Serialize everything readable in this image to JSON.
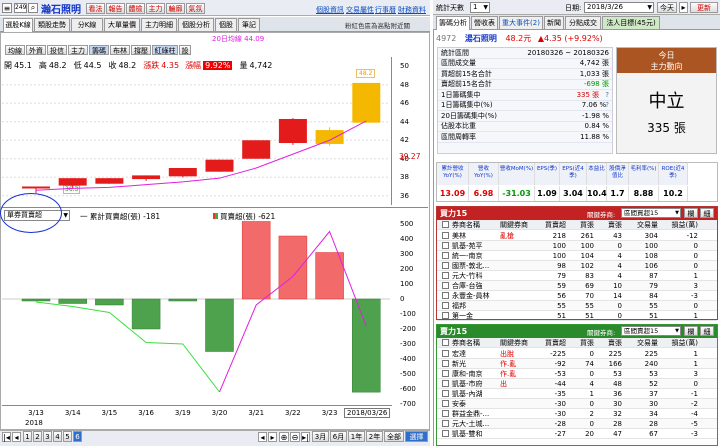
{
  "left_toolbar": {
    "code": "2499",
    "name": "瀚石照明",
    "buttons": [
      "看法",
      "報告",
      "體檢",
      "主力",
      "輪廓",
      "氣氛"
    ],
    "links": [
      "個股資訊",
      "交易屬性",
      "行事曆",
      "財務資料"
    ]
  },
  "left_tabs": [
    "選股K線",
    "類股走勢",
    "分K線",
    "大單量價",
    "主力明細",
    "個股分析",
    "個股",
    "筆記"
  ],
  "subtitle": "粉紅色區為高點附近關",
  "chart_buttons": [
    "均線",
    "外資",
    "投信",
    "主力",
    "籌碼",
    "布林",
    "撐壓",
    "紅綠柱",
    "設"
  ],
  "ohlc": {
    "open_label": "開",
    "open": "45.1",
    "high_label": "高",
    "high": "48.2",
    "low_label": "低",
    "low": "44.5",
    "close_label": "收",
    "close": "48.2",
    "chg_label": "漲跌",
    "chg": "4.35",
    "pct_label": "漲幅",
    "pct": "9.92%",
    "vol_label": "量",
    "vol": "4,742"
  },
  "legend_ma": "20日均線 44.09",
  "price_axis": [
    "50",
    "48",
    "46",
    "44",
    "42",
    "40",
    "38",
    "36"
  ],
  "price_current": "39.27",
  "peak_label": "48.2",
  "low_label": "36.3",
  "indicator": {
    "select": "單券買賣超",
    "series1": "一 累計買賣超(張)",
    "val1": "-181",
    "series2": "買賣超(張)",
    "val2": "-621"
  },
  "ind_axis": [
    "500",
    "400",
    "300",
    "200",
    "100",
    "0",
    "-100",
    "-200",
    "-300",
    "-400",
    "-500",
    "-600",
    "-700"
  ],
  "x_dates": [
    "3/13",
    "3/14",
    "3/15",
    "3/16",
    "3/19",
    "3/20",
    "3/21",
    "3/22",
    "3/23"
  ],
  "x_year": "2018",
  "x_cursor": "2018/03/26",
  "bottom_bar": {
    "pages": [
      "1",
      "2",
      "3",
      "4",
      "5",
      "6"
    ],
    "ranges": [
      "3月",
      "6月",
      "1年",
      "2年",
      "全部",
      "選擇"
    ]
  },
  "right_top": {
    "label": "統計天數",
    "days": "1",
    "date_label": "日期:",
    "date": "2018/3/26",
    "today": "今天",
    "refresh": "更新"
  },
  "right_tabs": [
    "籌碼分析",
    "營收表",
    "重大事件(2)",
    "新聞",
    "分點成交",
    "法人目標(45元)"
  ],
  "stock_header": {
    "code": "4972",
    "name": "湯石照明",
    "price": "48.2元",
    "chg": "▲4.35 (+9.92%)"
  },
  "stats": [
    {
      "k": "統計區間",
      "v": "20180326 ~ 20180326"
    },
    {
      "k": "區間成交量",
      "v": "4,742 張"
    },
    {
      "k": "買超前15名合計",
      "v": "1,033 張"
    },
    {
      "k": "賣超前15名合計",
      "v": "-698 張"
    },
    {
      "k": "1日籌碼集中",
      "v": "335 張"
    },
    {
      "k": "1日籌碼集中(%)",
      "v": "7.06 %"
    },
    {
      "k": "20日籌碼集中(%)",
      "v": "-1.98 %"
    },
    {
      "k": "佔股本比重",
      "v": "0.84 %"
    },
    {
      "k": "區間周轉率",
      "v": "11.88 %"
    }
  ],
  "today_box": {
    "t1": "今日",
    "t2": "主力動向",
    "status": "中立",
    "amount": "335 張"
  },
  "metrics": {
    "headers": [
      "累計營收YoY(%)",
      "營收YoY(%)",
      "營收MoM(%)",
      "EPS(季)",
      "EPS(近4季)",
      "本益比",
      "股價淨值比",
      "毛利率(%)",
      "ROE(近4季)"
    ],
    "values": [
      "13.09",
      "6.98",
      "-31.03",
      "1.09",
      "3.04",
      "10.4",
      "1.7",
      "8.88",
      "10.2"
    ]
  },
  "buy_table": {
    "title": "買力15",
    "ask": "關鍵券商:",
    "select": "區間買超15",
    "b1": "欄",
    "b2": "細",
    "headers": [
      "券商名稱",
      "關鍵券商",
      "買賣超",
      "買張",
      "賣張",
      "交易量",
      "損益(萬)"
    ],
    "rows": [
      [
        "美林",
        "亂槍",
        "218",
        "261",
        "43",
        "304",
        "-12"
      ],
      [
        "凱基-苑平",
        "",
        "100",
        "100",
        "0",
        "100",
        "0"
      ],
      [
        "統一-南京",
        "",
        "100",
        "104",
        "4",
        "108",
        "0"
      ],
      [
        "國票-敦北...",
        "",
        "98",
        "102",
        "4",
        "106",
        "0"
      ],
      [
        "元大-竹科",
        "",
        "79",
        "83",
        "4",
        "87",
        "1"
      ],
      [
        "合庫-台強",
        "",
        "59",
        "69",
        "10",
        "79",
        "3"
      ],
      [
        "永豐金-員林",
        "",
        "56",
        "70",
        "14",
        "84",
        "-3"
      ],
      [
        "福邦",
        "",
        "55",
        "55",
        "0",
        "55",
        "0"
      ],
      [
        "第一金",
        "",
        "51",
        "51",
        "0",
        "51",
        "1"
      ]
    ]
  },
  "sell_table": {
    "title": "賣力15",
    "ask": "關鍵券商:",
    "select": "區間賣超15",
    "b1": "欄",
    "b2": "細",
    "headers": [
      "券商名稱",
      "關鍵券商",
      "買賣超",
      "買張",
      "賣張",
      "交易量",
      "損益(萬)"
    ],
    "rows": [
      [
        "宏達",
        "出脫",
        "-225",
        "0",
        "225",
        "225",
        "1"
      ],
      [
        "新光",
        "作.亂",
        "-92",
        "74",
        "166",
        "240",
        "1"
      ],
      [
        "康和-南京",
        "作.亂",
        "-53",
        "0",
        "53",
        "53",
        "3"
      ],
      [
        "凱基-市府",
        "出",
        "-44",
        "4",
        "48",
        "52",
        "0"
      ],
      [
        "凱基-內湖",
        "",
        "-35",
        "1",
        "36",
        "37",
        "-1"
      ],
      [
        "安泰",
        "",
        "-30",
        "0",
        "30",
        "30",
        "-2"
      ],
      [
        "群益金鼎-...",
        "",
        "-30",
        "2",
        "32",
        "34",
        "-4"
      ],
      [
        "元大-土城...",
        "",
        "-28",
        "0",
        "28",
        "28",
        "-5"
      ],
      [
        "凱基-雙和",
        "",
        "-27",
        "20",
        "47",
        "67",
        "-3"
      ]
    ]
  },
  "chart_data": {
    "type": "candlestick",
    "x": [
      "3/13",
      "3/14",
      "3/15",
      "3/16",
      "3/19",
      "3/20",
      "3/21",
      "3/22",
      "3/23",
      "3/26"
    ],
    "ylim": [
      35,
      51
    ],
    "candles": [
      {
        "o": 36.8,
        "h": 37.0,
        "c": 37.0,
        "l": 36.3,
        "color": "red"
      },
      {
        "o": 37.1,
        "h": 37.9,
        "c": 37.9,
        "l": 36.8,
        "color": "red"
      },
      {
        "o": 37.3,
        "h": 37.9,
        "c": 37.9,
        "l": 37.3,
        "color": "red"
      },
      {
        "o": 37.8,
        "h": 38.2,
        "c": 38.2,
        "l": 37.6,
        "color": "red"
      },
      {
        "o": 38.1,
        "h": 39.0,
        "c": 39.0,
        "l": 38.0,
        "color": "red"
      },
      {
        "o": 38.6,
        "h": 39.9,
        "c": 39.9,
        "l": 38.6,
        "color": "red"
      },
      {
        "o": 40.0,
        "h": 42.0,
        "c": 42.0,
        "l": 40.0,
        "color": "red"
      },
      {
        "o": 41.7,
        "h": 44.4,
        "c": 44.3,
        "l": 41.5,
        "color": "red"
      },
      {
        "o": 41.6,
        "h": 43.4,
        "c": 43.1,
        "l": 41.4,
        "color": "yellow"
      },
      {
        "o": 43.9,
        "h": 48.2,
        "c": 48.2,
        "l": 43.9,
        "color": "yellow"
      }
    ],
    "ma": [
      36.6,
      36.8,
      36.9,
      37.2,
      37.5,
      37.9,
      39.0,
      40.5,
      42.0,
      44.09
    ],
    "net_buy": [
      -10,
      -30,
      -40,
      -200,
      -10,
      -350,
      650,
      420,
      310,
      -621
    ],
    "cumulative": [
      -20,
      -50,
      -90,
      -290,
      -300,
      -620,
      -40,
      150,
      450,
      -181
    ],
    "ind_ylim": [
      -700,
      520
    ]
  }
}
